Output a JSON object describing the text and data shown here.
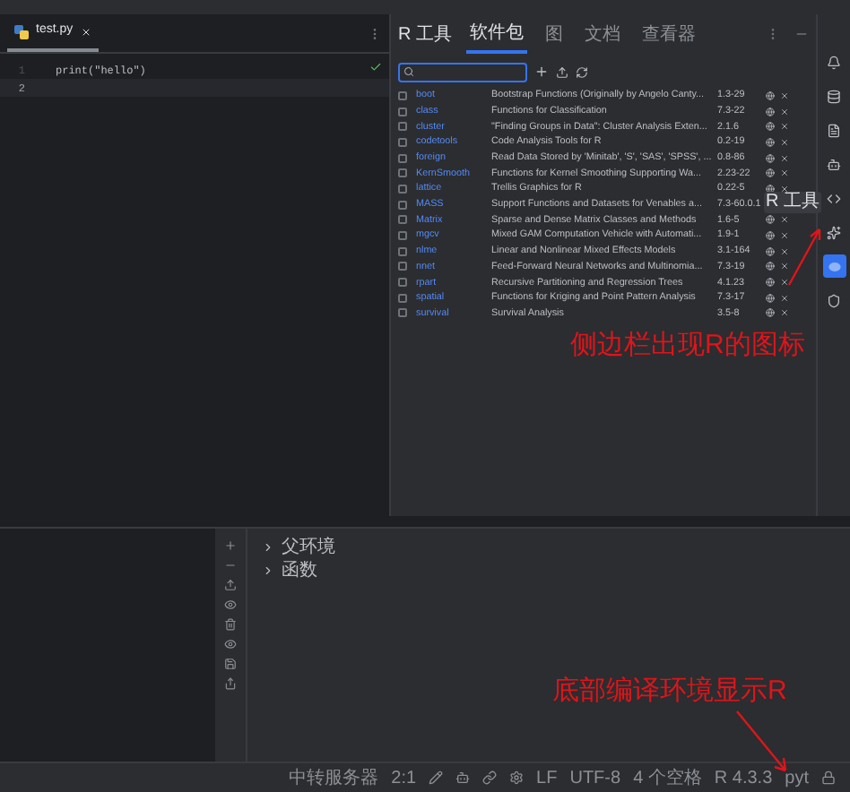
{
  "editor": {
    "tabs": [
      {
        "label": "test.py",
        "selected": true
      }
    ],
    "lines": [
      {
        "number": "1",
        "code": "print(\"hello\")",
        "current": false
      },
      {
        "number": "2",
        "current": true
      }
    ]
  },
  "r_tools": {
    "title": "R 工具",
    "tabs": [
      {
        "label": "软件包",
        "selected": true
      },
      {
        "label": "图",
        "selected": false
      },
      {
        "label": "文档",
        "selected": false
      },
      {
        "label": "查看器",
        "selected": false
      }
    ],
    "packages": [
      {
        "name": "boot",
        "description": "Bootstrap Functions (Originally by Angelo Canty...",
        "version": "1.3-29",
        "checked": false
      },
      {
        "name": "class",
        "description": "Functions for Classification",
        "version": "7.3-22",
        "checked": false
      },
      {
        "name": "cluster",
        "description": "\"Finding Groups in Data\": Cluster Analysis Exten...",
        "version": "2.1.6",
        "checked": false
      },
      {
        "name": "codetools",
        "description": "Code Analysis Tools for R",
        "version": "0.2-19",
        "checked": false
      },
      {
        "name": "foreign",
        "description": "Read Data Stored by 'Minitab', 'S', 'SAS', 'SPSS', ...",
        "version": "0.8-86",
        "checked": false
      },
      {
        "name": "KernSmooth",
        "description": "Functions for Kernel Smoothing Supporting Wa...",
        "version": "2.23-22",
        "checked": false
      },
      {
        "name": "lattice",
        "description": "Trellis Graphics for R",
        "version": "0.22-5",
        "checked": false
      },
      {
        "name": "MASS",
        "description": "Support Functions and Datasets for Venables a...",
        "version": "7.3-60.0.1",
        "checked": false
      },
      {
        "name": "Matrix",
        "description": "Sparse and Dense Matrix Classes and Methods",
        "version": "1.6-5",
        "checked": false
      },
      {
        "name": "mgcv",
        "description": "Mixed GAM Computation Vehicle with Automati...",
        "version": "1.9-1",
        "checked": false
      },
      {
        "name": "nlme",
        "description": "Linear and Nonlinear Mixed Effects Models",
        "version": "3.1-164",
        "checked": false
      },
      {
        "name": "nnet",
        "description": "Feed-Forward Neural Networks and Multinomia...",
        "version": "7.3-19",
        "checked": false
      },
      {
        "name": "rpart",
        "description": "Recursive Partitioning and Regression Trees",
        "version": "4.1.23",
        "checked": false
      },
      {
        "name": "spatial",
        "description": "Functions for Kriging and Point Pattern Analysis",
        "version": "7.3-17",
        "checked": false
      },
      {
        "name": "survival",
        "description": "Survival Analysis",
        "version": "3.5-8",
        "checked": false
      }
    ]
  },
  "sidebar": {
    "items": [
      {
        "kind": "bell",
        "selected": false
      },
      {
        "kind": "database",
        "selected": false
      },
      {
        "kind": "file",
        "selected": false
      },
      {
        "kind": "bot",
        "selected": false
      },
      {
        "kind": "code",
        "selected": false
      },
      {
        "kind": "sparkle",
        "selected": false
      },
      {
        "kind": "r",
        "selected": true
      },
      {
        "kind": "shield",
        "selected": false
      }
    ],
    "tooltip": "R 工具"
  },
  "bottom_panel": {
    "tree": [
      {
        "label": "父环境",
        "expanded": false
      },
      {
        "label": "函数",
        "expanded": false
      }
    ]
  },
  "status_bar": {
    "items": [
      {
        "kind": "text",
        "label": "中转服务器"
      },
      {
        "kind": "text",
        "label": "2:1"
      },
      {
        "kind": "icon"
      },
      {
        "kind": "icon"
      },
      {
        "kind": "icon"
      },
      {
        "kind": "icon"
      },
      {
        "kind": "text",
        "label": "LF"
      },
      {
        "kind": "text",
        "label": "UTF-8"
      },
      {
        "kind": "text",
        "label": "4 个空格"
      },
      {
        "kind": "text",
        "label": "R 4.3.3"
      },
      {
        "kind": "text",
        "label": "pyt"
      },
      {
        "kind": "icon"
      }
    ]
  },
  "annotations": [
    {
      "text": "侧边栏出现R的图标"
    },
    {
      "text": "底部编译环境显示R"
    }
  ]
}
